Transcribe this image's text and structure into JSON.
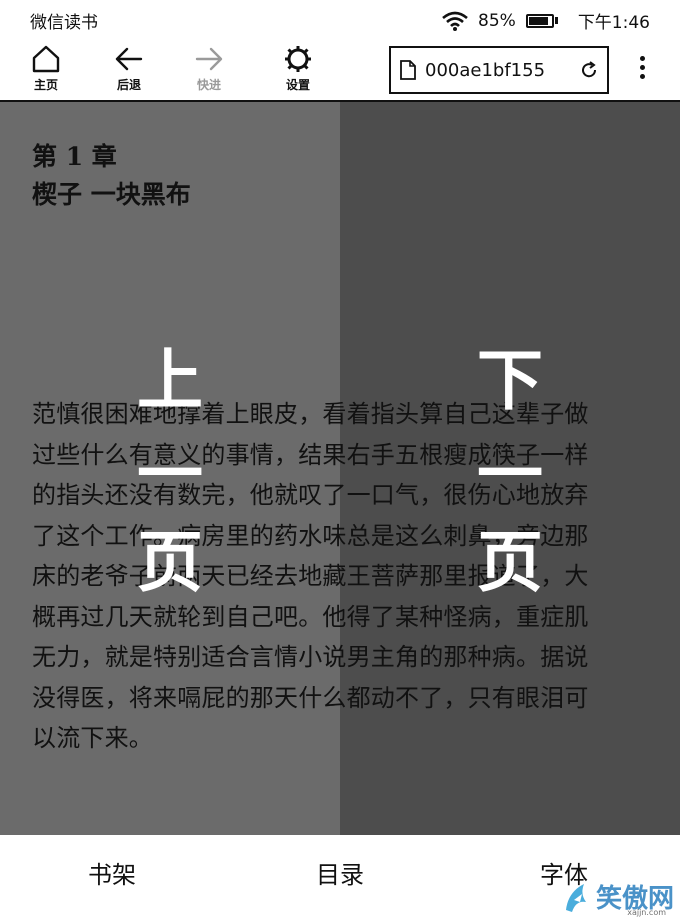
{
  "status_bar": {
    "app_name": "微信读书",
    "battery": "85%",
    "battery_level": 0.85,
    "time": "下午1:46"
  },
  "toolbar": {
    "home_label": "主页",
    "back_label": "后退",
    "forward_label": "快进",
    "settings_label": "设置",
    "url_text": "000ae1bf155"
  },
  "reader": {
    "chapter_number": "第 1 章",
    "chapter_title": "楔子 一块黑布",
    "lines": [
      "范慎很困难地撑着上眼皮，看着指头算自己这辈子做",
      "过些什么有意义的事情，结果右手五根瘦成筷子一样",
      "的指头还没有数完，他就叹了一口气，很伤心地放弃",
      "了这个工作。病房里的药水味总是这么刺鼻，旁边那",
      "床的老爷子前两天已经去地藏王菩萨那里报道了，大",
      "概再过几天就轮到自己吧。他得了某种怪病，重症肌",
      "无力，就是特别适合言情小说男主角的那种病。据说",
      "没得医，将来嗝屁的那天什么都动不了，只有眼泪可",
      "以流下来。"
    ]
  },
  "tap_zones": {
    "prev": [
      "上",
      "一",
      "页"
    ],
    "next": [
      "下",
      "一",
      "页"
    ]
  },
  "bottom_bar": {
    "bookshelf": "书架",
    "toc": "目录",
    "font": "字体"
  },
  "watermark": {
    "text": "笑傲网",
    "sub": "xajjn.com"
  }
}
